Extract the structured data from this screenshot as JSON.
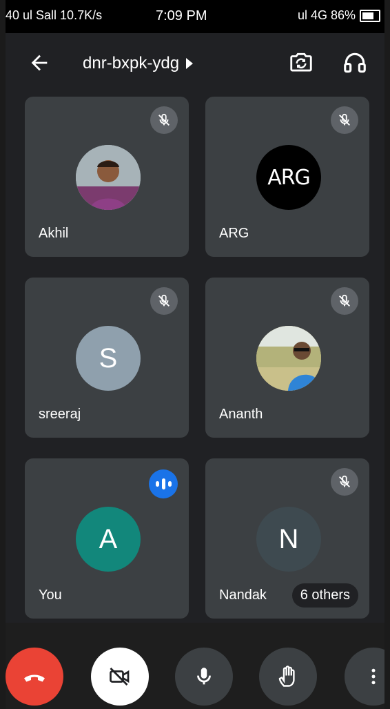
{
  "status_bar": {
    "left_text": "40 ul  Sall 10.7K/s",
    "time": "7:09 PM",
    "right_text": "ul 4G 86%"
  },
  "app_bar": {
    "meeting_code": "dnr-bxpk-ydg",
    "back_icon": "arrow-left-icon",
    "switch_camera_icon": "camera-switch-icon",
    "audio_icon": "headphones-icon"
  },
  "participants": [
    {
      "name": "Akhil",
      "avatar_type": "photo",
      "muted": true
    },
    {
      "name": "ARG",
      "avatar_type": "logo",
      "avatar_text": "ARG",
      "muted": true
    },
    {
      "name": "sreeraj",
      "avatar_type": "initial",
      "initial": "S",
      "avatar_color": "#8fa0ad",
      "muted": true
    },
    {
      "name": "Ananth",
      "avatar_type": "photo",
      "muted": true
    },
    {
      "name": "You",
      "avatar_type": "initial",
      "initial": "A",
      "avatar_color": "#12877b",
      "speaking": true
    },
    {
      "name": "Nandak",
      "avatar_type": "initial",
      "initial": "N",
      "avatar_color": "#3e4a50",
      "muted": true,
      "others_label": "6 others"
    }
  ],
  "controls": {
    "end_call_icon": "phone-hangup-icon",
    "camera_icon": "camera-off-icon",
    "mic_icon": "microphone-icon",
    "hand_icon": "raise-hand-icon",
    "more_icon": "more-vert-icon",
    "colors": {
      "end_call": "#ea4335",
      "camera": "#ffffff",
      "dark": "#3c4043",
      "speaking": "#1a73e8"
    }
  }
}
